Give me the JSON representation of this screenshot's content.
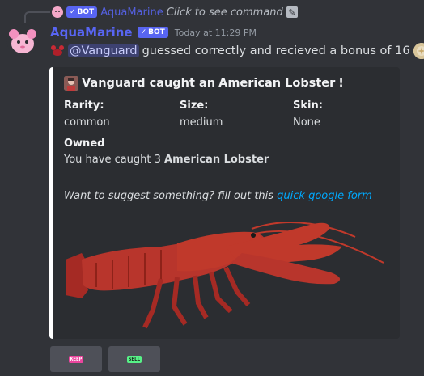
{
  "reply": {
    "bot_tag": "BOT",
    "name": "AquaMarine",
    "command": "Click to see command"
  },
  "message": {
    "author": "AquaMarine",
    "bot_tag": "BOT",
    "timestamp": "Today at 11:29 PM",
    "mention": "@Vanguard",
    "text": "guessed correctly and recieved a bonus of 16",
    "trailing": "!"
  },
  "embed": {
    "accent_color": "#ffffff",
    "title_prefix": "Vanguard caught an ",
    "title_bold": "American Lobster",
    "title_suffix": "!",
    "fields": {
      "rarity_name": "Rarity:",
      "rarity_value": "common",
      "size_name": "Size:",
      "size_value": "medium",
      "skin_name": "Skin:",
      "skin_value": "None",
      "owned_name": "Owned",
      "owned_prefix": "You have caught 3 ",
      "owned_bold": "American Lobster"
    },
    "footer_text": "Want to suggest something? fill out this ",
    "footer_link": "quick google form"
  },
  "buttons": [
    {
      "label": "KEEP",
      "color": "#eb459e"
    },
    {
      "label": "SELL",
      "color": "#57f287"
    }
  ],
  "icons": {
    "verified": "check-icon",
    "edit": "pencil-icon"
  }
}
